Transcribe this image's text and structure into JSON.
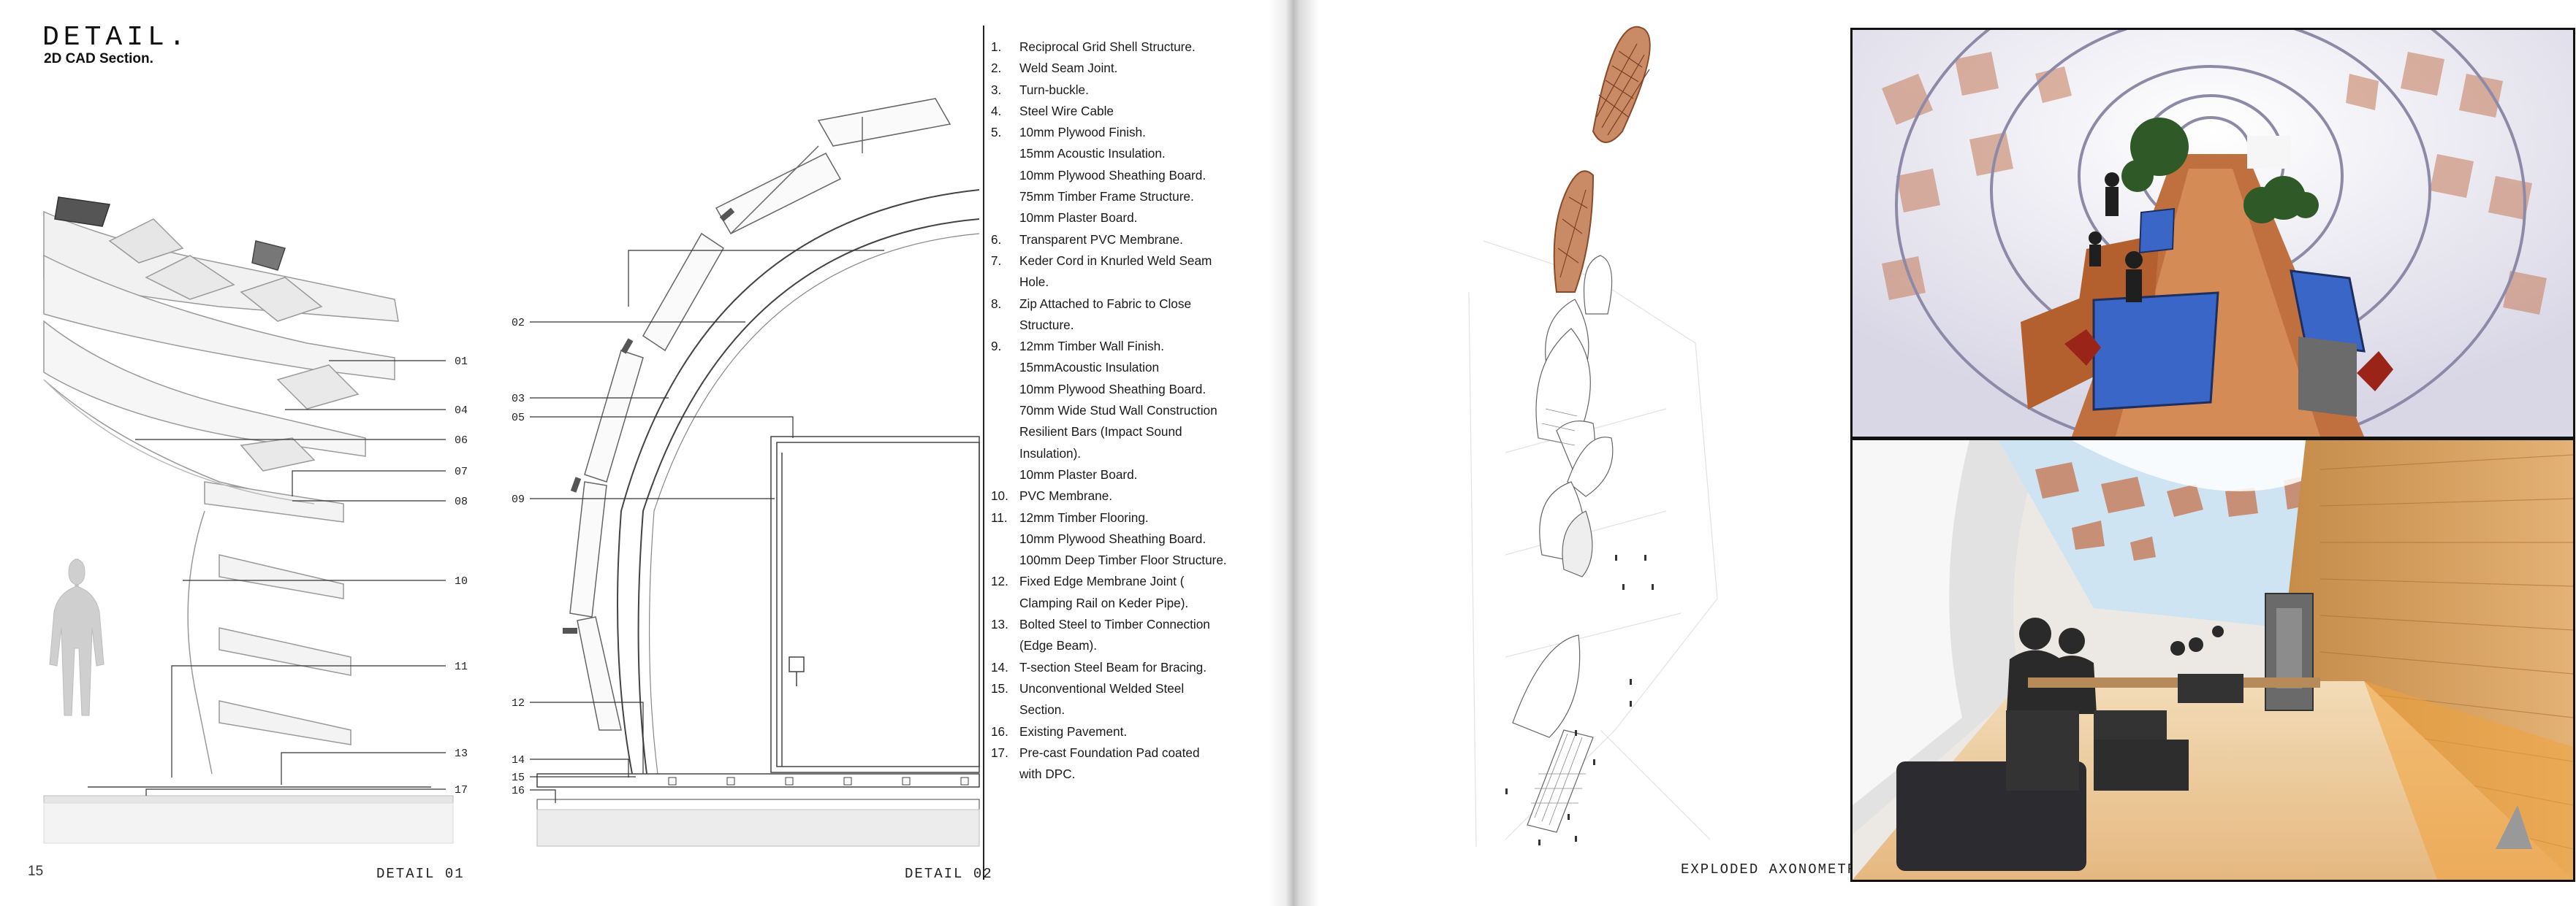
{
  "left_page": {
    "title": "DETAIL.",
    "subtitle": "2D CAD Section.",
    "page_number": "15",
    "detail_01_caption": "DETAIL 01",
    "detail_02_caption": "DETAIL 02",
    "detail_01_callouts": [
      "01",
      "04",
      "06",
      "07",
      "08",
      "10",
      "11",
      "13",
      "17"
    ],
    "detail_02_callouts": [
      "02",
      "03",
      "05",
      "09",
      "12",
      "14",
      "15",
      "16"
    ],
    "notes": [
      {
        "num": "1.",
        "lines": [
          "Reciprocal Grid Shell Structure."
        ]
      },
      {
        "num": "2.",
        "lines": [
          "Weld Seam Joint."
        ]
      },
      {
        "num": "3.",
        "lines": [
          "Turn-buckle."
        ]
      },
      {
        "num": "4.",
        "lines": [
          "Steel Wire Cable"
        ]
      },
      {
        "num": "5.",
        "lines": [
          "10mm Plywood Finish.",
          "15mm Acoustic Insulation.",
          "10mm Plywood Sheathing Board.",
          "75mm Timber Frame Structure.",
          "10mm Plaster Board."
        ]
      },
      {
        "num": "6.",
        "lines": [
          "Transparent PVC Membrane."
        ]
      },
      {
        "num": "7.",
        "lines": [
          "Keder Cord in Knurled Weld Seam",
          "Hole."
        ]
      },
      {
        "num": "8.",
        "lines": [
          "Zip Attached to Fabric to Close",
          "Structure."
        ]
      },
      {
        "num": "9.",
        "lines": [
          "12mm Timber Wall Finish.",
          "15mmAcoustic Insulation",
          "10mm Plywood Sheathing Board.",
          "70mm Wide Stud Wall Construction",
          "Resilient Bars (Impact Sound",
          "Insulation).",
          "10mm Plaster Board."
        ]
      },
      {
        "num": "10.",
        "lines": [
          "PVC Membrane."
        ]
      },
      {
        "num": "11.",
        "lines": [
          "12mm Timber Flooring.",
          "10mm Plywood Sheathing Board.",
          "100mm Deep Timber Floor Structure."
        ]
      },
      {
        "num": "12.",
        "lines": [
          "Fixed Edge Membrane Joint (",
          "Clamping Rail on Keder Pipe)."
        ]
      },
      {
        "num": "13.",
        "lines": [
          "Bolted Steel to Timber Connection",
          "(Edge Beam)."
        ]
      },
      {
        "num": "14.",
        "lines": [
          "T-section Steel Beam for Bracing."
        ]
      },
      {
        "num": "15.",
        "lines": [
          "Unconventional Welded Steel",
          "Section."
        ]
      },
      {
        "num": "16.",
        "lines": [
          "Existing Pavement."
        ]
      },
      {
        "num": "17.",
        "lines": [
          "Pre-cast Foundation Pad coated",
          "with DPC."
        ]
      }
    ]
  },
  "right_page": {
    "exploded_caption": "EXPLODED AXONOMETRIC"
  },
  "colors": {
    "timber": "#b2643a",
    "glass_table": "#3a66c8",
    "ink": "#222222"
  }
}
